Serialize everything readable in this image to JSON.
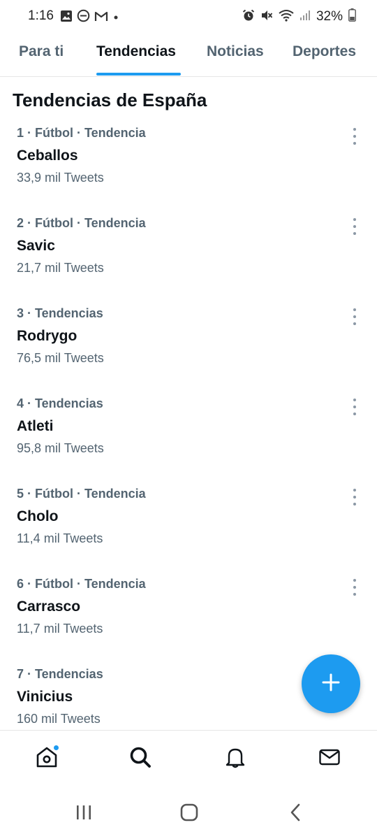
{
  "status_bar": {
    "time": "1:16",
    "battery": "32%",
    "left_icons": [
      "image-icon",
      "do-not-disturb-icon",
      "gmail-icon",
      "dot-icon"
    ],
    "right_icons": [
      "alarm-icon",
      "mute-icon",
      "wifi-icon",
      "signal-icon",
      "battery-icon"
    ]
  },
  "tabs": [
    {
      "label": "Para ti",
      "active": false
    },
    {
      "label": "Tendencias",
      "active": true
    },
    {
      "label": "Noticias",
      "active": false
    },
    {
      "label": "Deportes",
      "active": false
    }
  ],
  "section_title": "Tendencias de España",
  "trends": [
    {
      "meta": "1 · Fútbol · Tendencia",
      "name": "Ceballos",
      "count": "33,9 mil Tweets"
    },
    {
      "meta": "2 · Fútbol · Tendencia",
      "name": "Savic",
      "count": "21,7 mil Tweets"
    },
    {
      "meta": "3 · Tendencias",
      "name": "Rodrygo",
      "count": "76,5 mil Tweets"
    },
    {
      "meta": "4 · Tendencias",
      "name": "Atleti",
      "count": "95,8 mil Tweets"
    },
    {
      "meta": "5 · Fútbol · Tendencia",
      "name": "Cholo",
      "count": "11,4 mil Tweets"
    },
    {
      "meta": "6 · Fútbol · Tendencia",
      "name": "Carrasco",
      "count": "11,7 mil Tweets"
    },
    {
      "meta": "7 · Tendencias",
      "name": "Vinicius",
      "count": "160 mil Tweets"
    }
  ],
  "fab_icon": "plus-icon",
  "bottom_nav": [
    "home-icon",
    "search-icon",
    "bell-icon",
    "mail-icon"
  ],
  "system_nav": [
    "recents-icon",
    "home-button-icon",
    "back-icon"
  ],
  "colors": {
    "accent": "#1d9bf0",
    "text": "#0f1419",
    "secondary": "#536471"
  }
}
